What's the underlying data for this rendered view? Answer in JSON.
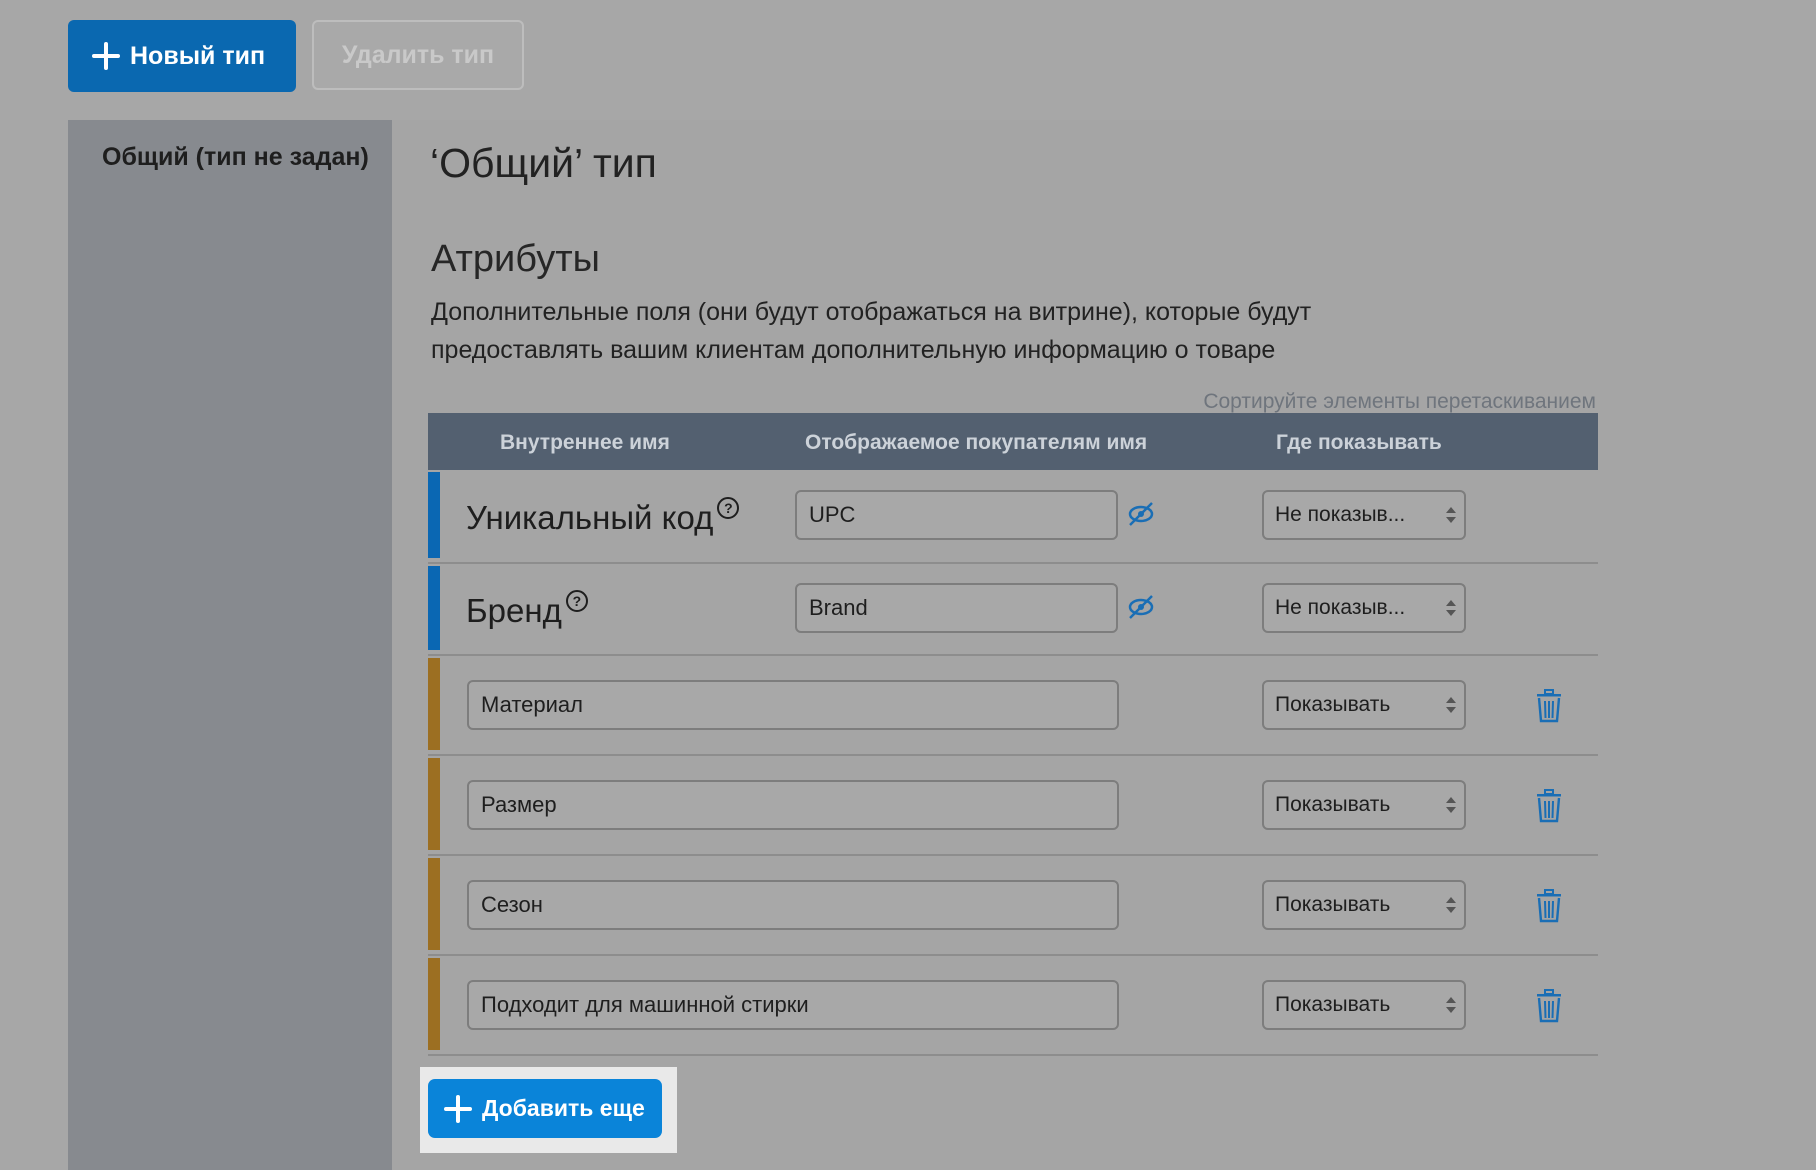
{
  "toolbar": {
    "new_type_label": "Новый тип",
    "delete_type_label": "Удалить тип"
  },
  "sidebar": {
    "items": [
      {
        "label": "Общий (тип не задан)"
      }
    ]
  },
  "main": {
    "title": "‘Общий’ тип",
    "attributes_heading": "Атрибуты",
    "attributes_description": "Дополнительные поля (они будут отображаться на витрине), которые будут предоставлять вашим клиентам дополнительную информацию о товаре",
    "sort_hint": "Сортируйте элементы перетаскиванием",
    "table": {
      "columns": [
        "Внутреннее имя",
        "Отображаемое покупателям имя",
        "Где показывать"
      ],
      "system_rows": [
        {
          "internal_name": "Уникальный код",
          "help": "?",
          "display_name": "UPC",
          "where": "Не показыв..."
        },
        {
          "internal_name": "Бренд",
          "help": "?",
          "display_name": "Brand",
          "where": "Не показыв..."
        }
      ],
      "custom_rows": [
        {
          "name": "Материал",
          "where": "Показывать"
        },
        {
          "name": "Размер",
          "where": "Показывать"
        },
        {
          "name": "Сезон",
          "where": "Показывать"
        },
        {
          "name": "Подходит для машинной стирки",
          "where": "Показывать"
        }
      ]
    },
    "add_more_label": "Добавить еще"
  },
  "colors": {
    "primary": "#0a68b0",
    "accent_button": "#0a84d9",
    "header_bg": "#536070",
    "system_stripe": "#0a67b3",
    "custom_stripe": "#9c6f22",
    "icon_blue": "#1a6eb5"
  },
  "icons": {
    "plus": "plus-icon",
    "help": "help-circle-icon",
    "hidden": "eye-slash-icon",
    "delete": "trash-icon",
    "select": "select-arrows-icon"
  }
}
